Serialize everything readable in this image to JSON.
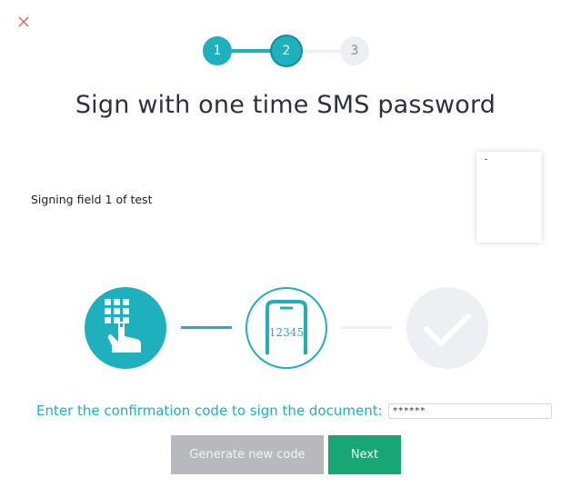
{
  "dialog": {
    "close_icon": "close-icon",
    "accent_color": "#1fb0bd",
    "close_color": "#e06a6a"
  },
  "stepper": {
    "steps": [
      {
        "label": "1",
        "state": "completed"
      },
      {
        "label": "2",
        "state": "current"
      },
      {
        "label": "3",
        "state": "upcoming"
      }
    ]
  },
  "title": "Sign with one time SMS password",
  "signing_field": "Signing field 1 of test",
  "process": {
    "icons": [
      "keypad-hand-icon",
      "phone-sms-code-icon",
      "checkmark-icon"
    ],
    "phone_code": "12345"
  },
  "confirmation": {
    "prompt": "Enter the confirmation code to sign the document:",
    "value": "******"
  },
  "buttons": {
    "generate": "Generate new code",
    "next": "Next",
    "generate_color": "#b7b9bd",
    "next_color": "#17a774"
  }
}
